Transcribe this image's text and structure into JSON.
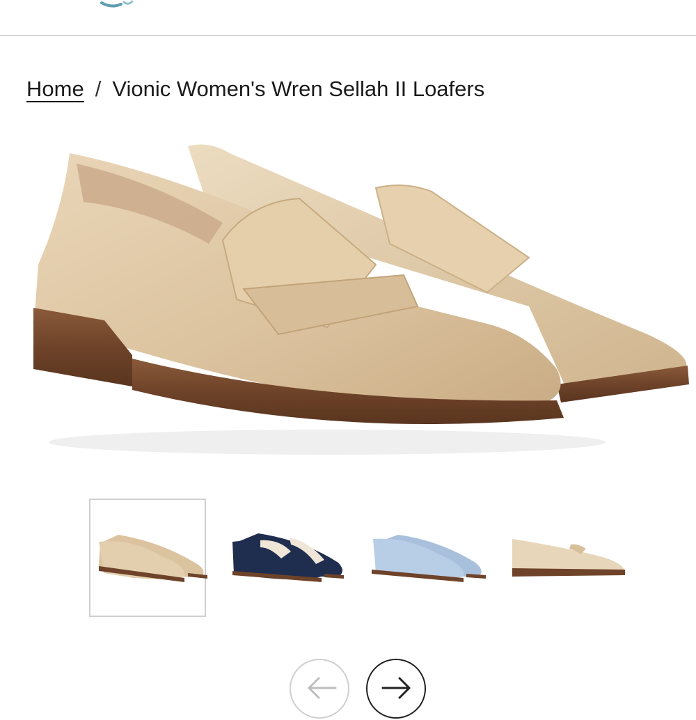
{
  "header": {
    "logo_icon": "vionic-logo-icon"
  },
  "breadcrumb": {
    "home_label": "Home",
    "separator": "/",
    "current_label": "Vionic Women's Wren Sellah II Loafers"
  },
  "product_gallery": {
    "main_image_icon": "loafer-pair-image",
    "selected_index": 0,
    "thumbnails": [
      {
        "color": "#e3cfae",
        "accent": "#e3cfae",
        "view": "pair"
      },
      {
        "color": "#1f2d4e",
        "accent": "#f0e6d8",
        "view": "pair"
      },
      {
        "color": "#b8cde6",
        "accent": "#b8cde6",
        "view": "pair"
      },
      {
        "color": "#e8d6ba",
        "accent": "#e8d6ba",
        "view": "side"
      }
    ],
    "prev_icon": "arrow-left-icon",
    "next_icon": "arrow-right-icon"
  }
}
